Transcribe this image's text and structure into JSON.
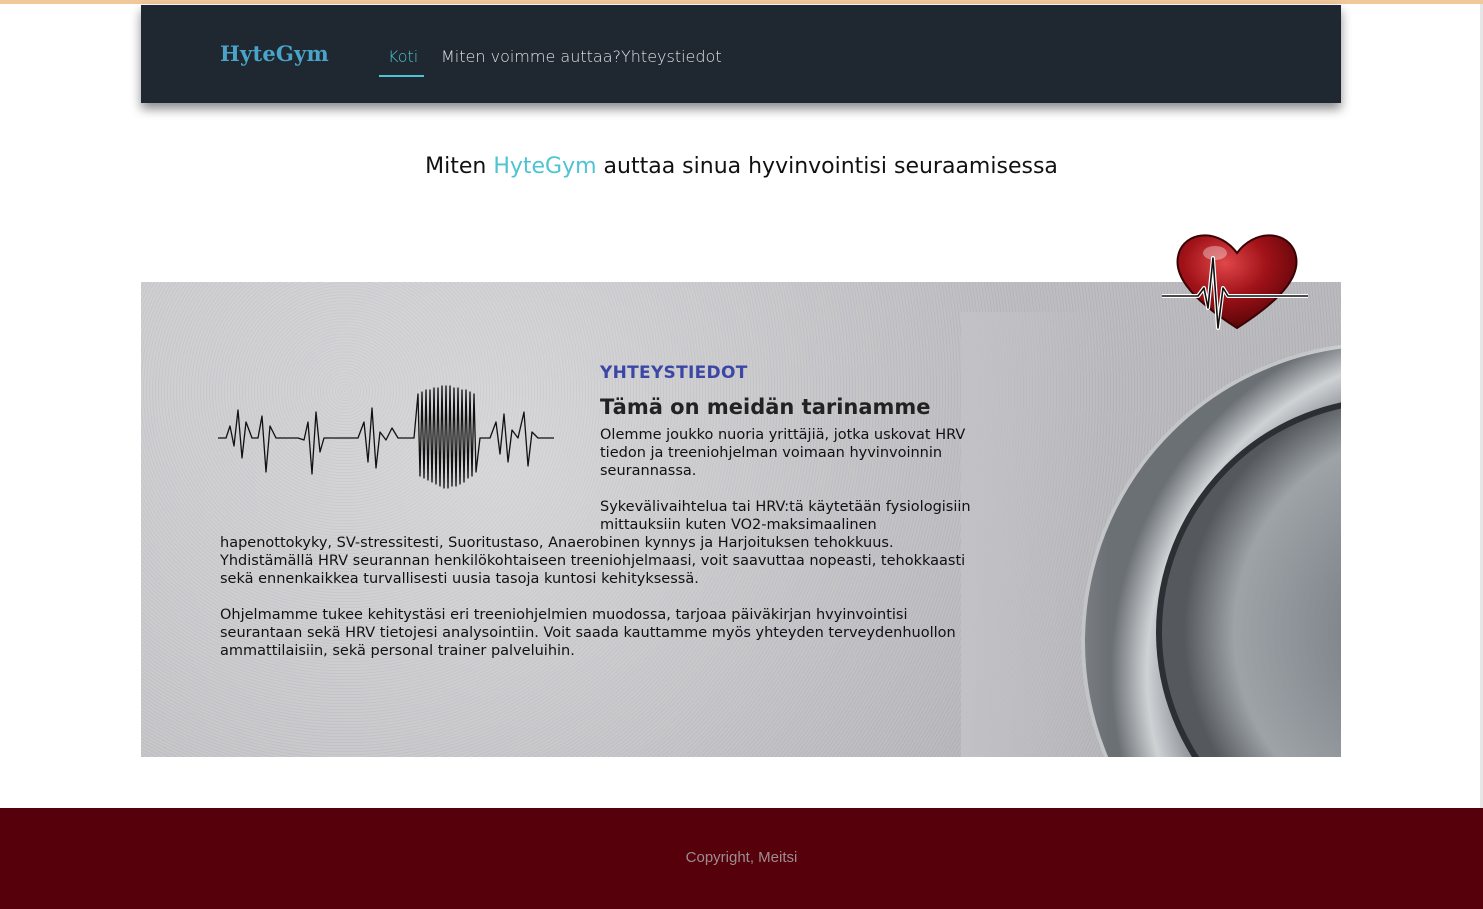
{
  "nav": {
    "brand": "HyteGym",
    "links": [
      {
        "label": "Koti",
        "active": true
      },
      {
        "label": "Miten voimme auttaa?",
        "active": false
      },
      {
        "label": "Yhteystiedot",
        "active": false
      }
    ]
  },
  "hero_title": {
    "prefix": "Miten ",
    "accent": "HyteGym",
    "suffix": " auttaa sinua hyvinvointisi seuraamisessa"
  },
  "story": {
    "eyebrow": "YHTEYSTIEDOT",
    "headline": "Tämä on meidän tarinamme",
    "paragraphs": [
      "Olemme joukko nuoria yrittäjiä, jotka uskovat HRV tiedon ja treeniohjelman voimaan hyvinvoinnin seurannassa.",
      "Sykevälivaihtelua tai HRV:tä käytetään fysiologisiin mittauksiin kuten VO2-maksimaalinen hapenottokyky, SV-stressitesti, Suoritustaso, Anaerobinen kynnys ja Harjoituksen tehokkuus. Yhdistämällä HRV seurannan henkilökohtaiseen treeniohjelmaasi, voit saavuttaa nopeasti, tehokkaasti sekä ennenkaikkea turvallisesti uusia tasoja kuntosi kehityksessä.",
      "Ohjelmamme tukee kehitystäsi eri treeniohjelmien muodossa, tarjoaa päiväkirjan hvyinvointisi seurantaan sekä HRV tietojesi analysointiin. Voit saada kauttamme myös yhteyden terveydenhuollon ammattilaisiin, sekä personal trainer palveluihin."
    ]
  },
  "footer": {
    "copyright": "Copyright, Meitsi"
  },
  "colors": {
    "navbar": "#1f2730",
    "accent": "#4dc3d4",
    "brand": "#4aa3c8",
    "eyebrow": "#3c46a4",
    "footer": "#56000b"
  },
  "icons": {
    "heart": "heart-with-heartbeat-icon",
    "ecg": "ecg-heartbeat-line-icon"
  }
}
